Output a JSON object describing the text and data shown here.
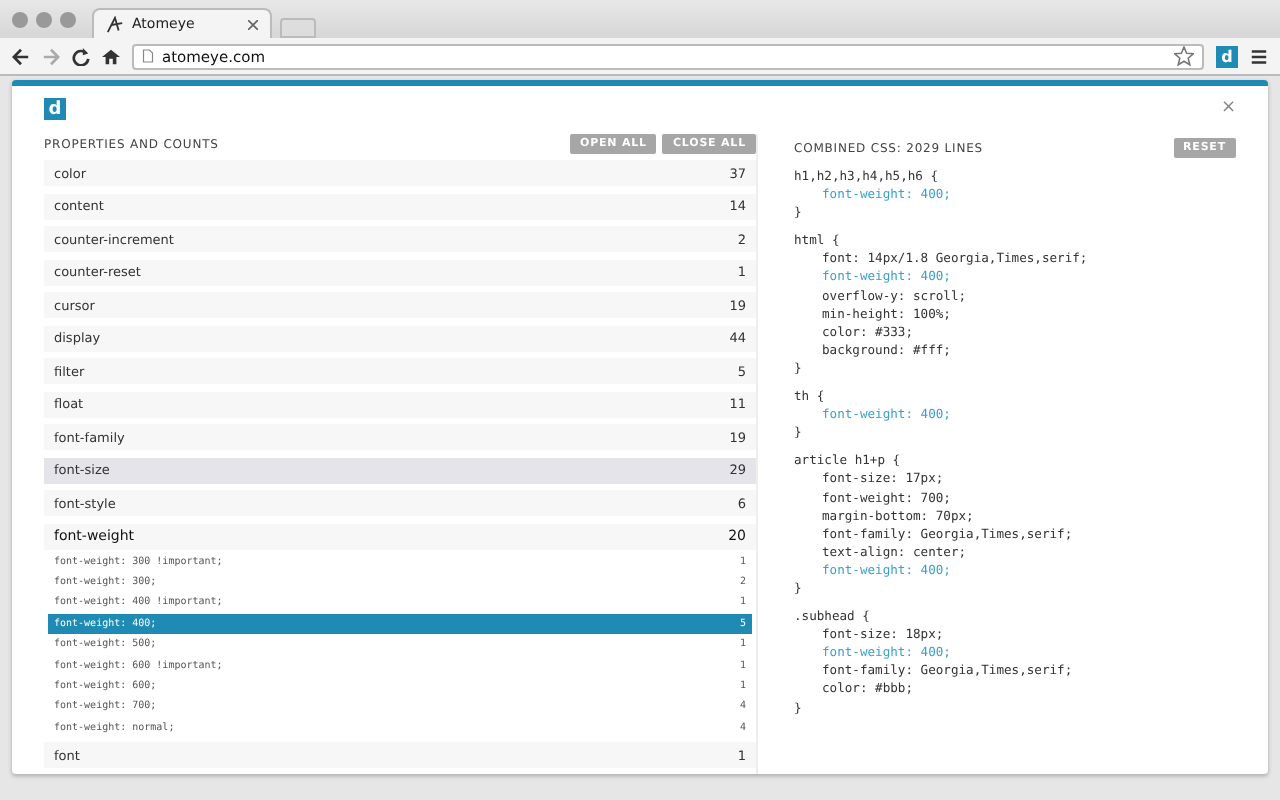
{
  "browser": {
    "tab_title": "Atomeye",
    "url": "atomeye.com",
    "extension_label": "d"
  },
  "panel": {
    "logo": "d",
    "close": "×"
  },
  "properties": {
    "heading": "PROPERTIES AND COUNTS",
    "buttons": [
      "OPEN ALL",
      "CLOSE ALL"
    ],
    "items": [
      {
        "name": "color",
        "count": "37",
        "expanded": false,
        "selected": false
      },
      {
        "name": "content",
        "count": "14",
        "expanded": false,
        "selected": false
      },
      {
        "name": "counter-increment",
        "count": "2",
        "expanded": false,
        "selected": false
      },
      {
        "name": "counter-reset",
        "count": "1",
        "expanded": false,
        "selected": false
      },
      {
        "name": "cursor",
        "count": "19",
        "expanded": false,
        "selected": false
      },
      {
        "name": "display",
        "count": "44",
        "expanded": false,
        "selected": false
      },
      {
        "name": "filter",
        "count": "5",
        "expanded": false,
        "selected": false
      },
      {
        "name": "float",
        "count": "11",
        "expanded": false,
        "selected": false
      },
      {
        "name": "font-family",
        "count": "19",
        "expanded": false,
        "selected": false
      },
      {
        "name": "font-size",
        "count": "29",
        "expanded": false,
        "selected": true
      },
      {
        "name": "font-style",
        "count": "6",
        "expanded": false,
        "selected": false
      },
      {
        "name": "font-weight",
        "count": "20",
        "expanded": true,
        "selected": false,
        "children": [
          {
            "value": "font-weight: 300 !important;",
            "count": "1",
            "selected": false
          },
          {
            "value": "font-weight: 300;",
            "count": "2",
            "selected": false
          },
          {
            "value": "font-weight: 400 !important;",
            "count": "1",
            "selected": false
          },
          {
            "value": "font-weight: 400;",
            "count": "5",
            "selected": true
          },
          {
            "value": "font-weight: 500;",
            "count": "1",
            "selected": false
          },
          {
            "value": "font-weight: 600 !important;",
            "count": "1",
            "selected": false
          },
          {
            "value": "font-weight: 600;",
            "count": "1",
            "selected": false
          },
          {
            "value": "font-weight: 700;",
            "count": "4",
            "selected": false
          },
          {
            "value": "font-weight: normal;",
            "count": "4",
            "selected": false
          }
        ]
      },
      {
        "name": "font",
        "count": "1",
        "expanded": false,
        "selected": false
      }
    ]
  },
  "css": {
    "heading": "COMBINED CSS: 2029 LINES",
    "button": "RESET",
    "blocks": [
      {
        "lines": [
          {
            "kind": "selector",
            "text": "h1,h2,h3,h4,h5,h6 {"
          },
          {
            "kind": "decl",
            "text": "font-weight: 400;",
            "highlighted": true
          },
          {
            "kind": "close",
            "text": "}"
          }
        ]
      },
      {
        "lines": [
          {
            "kind": "selector",
            "text": "html {"
          },
          {
            "kind": "decl",
            "text": "font: 14px/1.8 Georgia,Times,serif;",
            "highlighted": false
          },
          {
            "kind": "decl",
            "text": "font-weight: 400;",
            "highlighted": true
          },
          {
            "kind": "decl",
            "text": "overflow-y: scroll;",
            "highlighted": false
          },
          {
            "kind": "decl",
            "text": "min-height: 100%;",
            "highlighted": false
          },
          {
            "kind": "decl",
            "text": "color: #333;",
            "highlighted": false
          },
          {
            "kind": "decl",
            "text": "background: #fff;",
            "highlighted": false
          },
          {
            "kind": "close",
            "text": "}"
          }
        ]
      },
      {
        "lines": [
          {
            "kind": "selector",
            "text": "th {"
          },
          {
            "kind": "decl",
            "text": "font-weight: 400;",
            "highlighted": true
          },
          {
            "kind": "close",
            "text": "}"
          }
        ]
      },
      {
        "lines": [
          {
            "kind": "selector",
            "text": "article h1+p {"
          },
          {
            "kind": "decl",
            "text": "font-size: 17px;",
            "highlighted": false
          },
          {
            "kind": "decl",
            "text": "font-weight: 700;",
            "highlighted": false
          },
          {
            "kind": "decl",
            "text": "margin-bottom: 70px;",
            "highlighted": false
          },
          {
            "kind": "decl",
            "text": "font-family: Georgia,Times,serif;",
            "highlighted": false
          },
          {
            "kind": "decl",
            "text": "text-align: center;",
            "highlighted": false
          },
          {
            "kind": "decl",
            "text": "font-weight: 400;",
            "highlighted": true
          },
          {
            "kind": "close",
            "text": "}"
          }
        ]
      },
      {
        "lines": [
          {
            "kind": "selector",
            "text": ".subhead {"
          },
          {
            "kind": "decl",
            "text": "font-size: 18px;",
            "highlighted": false
          },
          {
            "kind": "decl",
            "text": "font-weight: 400;",
            "highlighted": true
          },
          {
            "kind": "decl",
            "text": "font-family: Georgia,Times,serif;",
            "highlighted": false
          },
          {
            "kind": "decl",
            "text": "color: #bbb;",
            "highlighted": false
          },
          {
            "kind": "close",
            "text": "}"
          }
        ]
      }
    ]
  }
}
